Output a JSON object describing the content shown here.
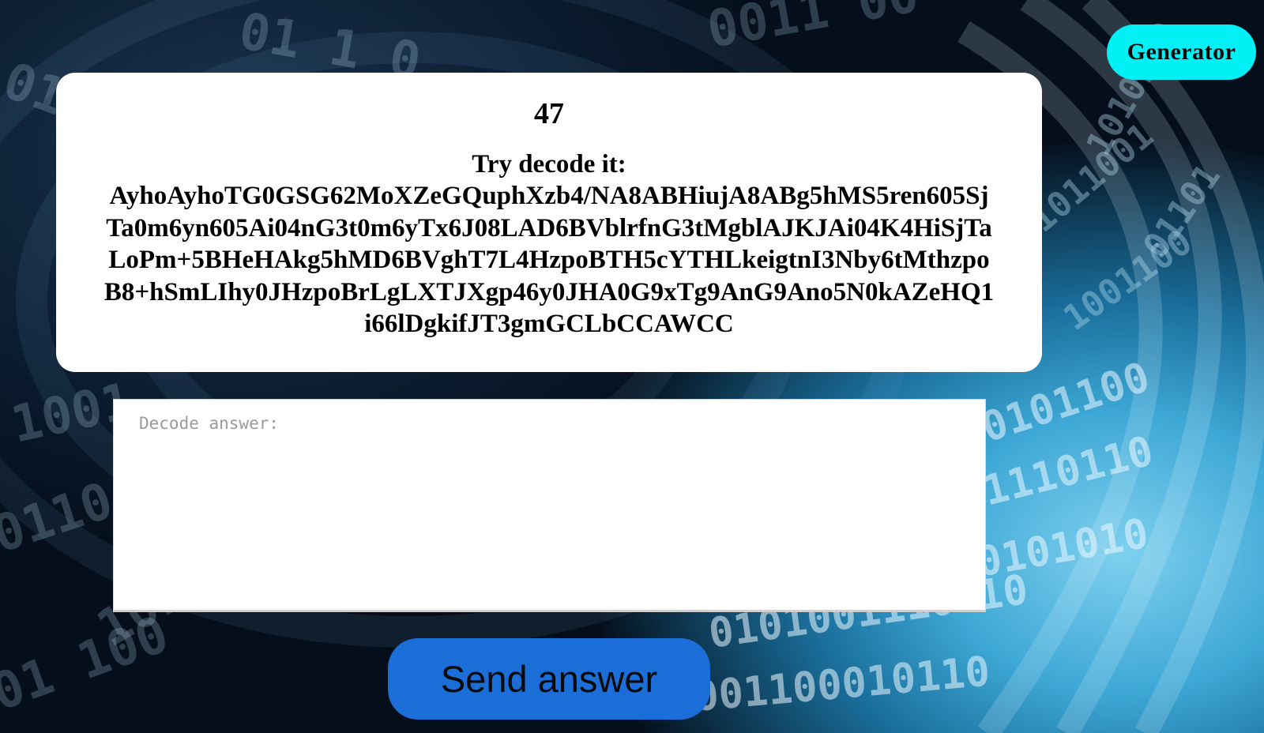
{
  "header": {
    "generator_label": "Generator"
  },
  "challenge": {
    "level": "47",
    "prompt": "Try decode it:",
    "cipher_text": "AyhoAyhoTG0GSG62MoXZeGQuphXzb4/NA8ABHiujA8ABg5hMS5ren605SjTa0m6yn605Ai04nG3t0m6yTx6J08LAD6BVblrfnG3tMgblAJKJAi04K4HiSjTaLoPm+5BHeHAkg5hMD6BVghT7L4HzpoBTH5cYTHLkeigtnI3Nby6tMthzpoB8+hSmLIhy0JHzpoBrLgLXTJXgp46y0JHA0G9xTg9AnG9Ano5N0kAZeHQ1i66lDgkifJT3gmGCLbCCAWCC"
  },
  "answer": {
    "placeholder": "Decode answer:",
    "value": ""
  },
  "actions": {
    "send_label": "Send answer"
  },
  "colors": {
    "generator_button": "#00f0f6",
    "send_button": "#1b6ed8",
    "card_background": "#ffffff"
  }
}
